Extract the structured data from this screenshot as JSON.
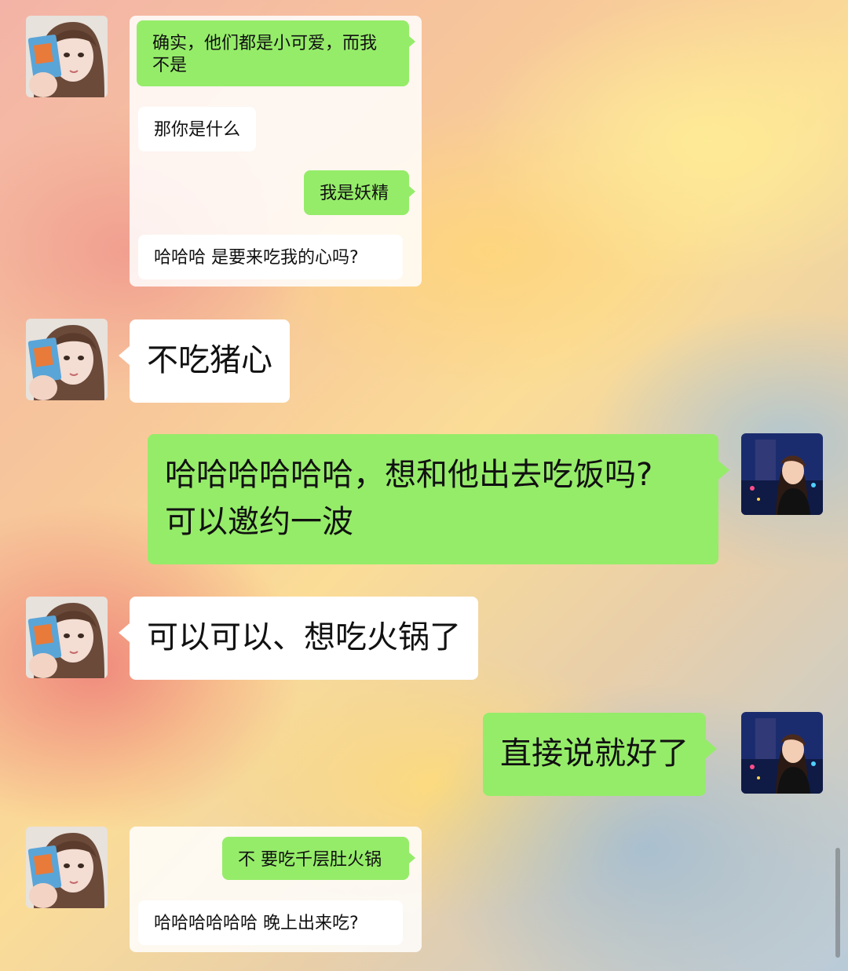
{
  "chat": {
    "messages": [
      {
        "text": "确实，他们都是小可爱，而我\n不是"
      },
      {
        "text": "那你是什么"
      },
      {
        "text": "我是妖精"
      },
      {
        "text": "哈哈哈 是要来吃我的心吗?"
      },
      {
        "text": "不吃猪心"
      },
      {
        "text": "哈哈哈哈哈哈，想和他出去吃饭吗?\n可以邀约一波"
      },
      {
        "text": "可以可以、想吃火锅了"
      },
      {
        "text": "直接说就好了"
      },
      {
        "text": "不 要吃千层肚火锅"
      },
      {
        "text": "哈哈哈哈哈哈 晚上出来吃?"
      }
    ]
  },
  "colors": {
    "green_bubble": "#95ec69",
    "white_bubble": "#ffffff"
  },
  "icons": {
    "left_avatar": "girl-holding-book-avatar",
    "right_avatar": "girl-night-city-avatar"
  }
}
